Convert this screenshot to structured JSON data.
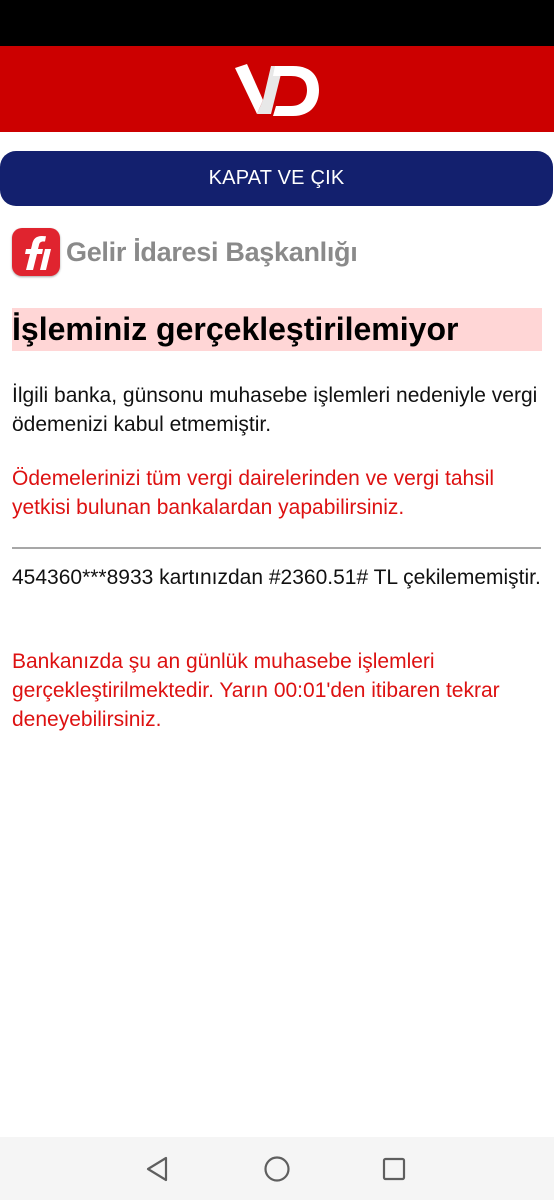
{
  "header": {
    "logo_icon": "ivd-logo-icon",
    "brand_color": "#cc0000"
  },
  "close_button": {
    "label": "KAPAT VE ÇIK",
    "color": "#13206e"
  },
  "gib": {
    "name": "Gelir İdaresi Başkanlığı",
    "icon": "gib-logo-icon"
  },
  "title": "İşleminiz gerçekleştirilemiyor",
  "message": {
    "reason": "İlgili banka, günsonu muhasebe işlemleri nedeniyle vergi ödemenizi kabul etmemiştir.",
    "advice": "Ödemelerinizi tüm vergi dairelerinden ve vergi tahsil yetkisi bulunan bankalardan yapabilirsiniz.",
    "card_result": "454360***8933 kartınızdan #2360.51# TL çekilememiştir.",
    "bank_notice": "Bankanızda şu an günlük muhasebe işlemleri gerçekleştirilmektedir. Yarın 00:01'den itibaren tekrar deneyebilirsiniz."
  },
  "colors": {
    "error_text": "#dd1111",
    "title_highlight": "#ffd6d6"
  },
  "nav": {
    "back_icon": "back-triangle-icon",
    "home_icon": "home-circle-icon",
    "recent_icon": "recent-apps-square-icon"
  }
}
